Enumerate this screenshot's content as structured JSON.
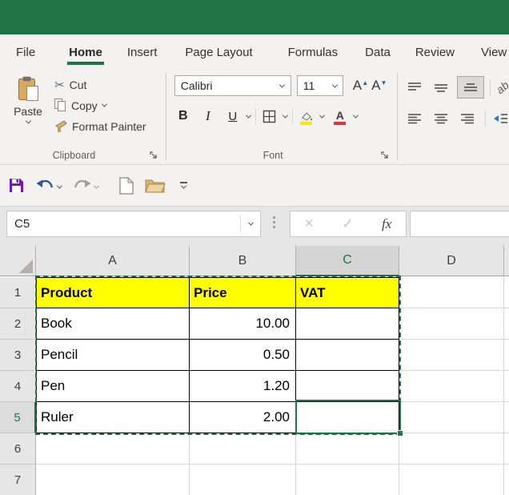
{
  "window": {
    "theme_color": "#217346"
  },
  "ribbon_tabs": [
    "File",
    "Home",
    "Insert",
    "Page Layout",
    "Formulas",
    "Data",
    "Review",
    "View"
  ],
  "active_tab": "Home",
  "clipboard": {
    "paste": "Paste",
    "cut": "Cut",
    "copy": "Copy",
    "format_painter": "Format Painter",
    "group_label": "Clipboard"
  },
  "font_group": {
    "font_name": "Calibri",
    "font_size": "11",
    "bold": "B",
    "italic": "I",
    "underline": "U",
    "grow_font": "A",
    "shrink_font": "A",
    "group_label": "Font",
    "fill_color": "#ffe600",
    "font_color_bar": "#e8322d"
  },
  "quick_access": {
    "buttons": [
      "save",
      "undo",
      "redo",
      "new-file",
      "open-folder",
      "customize"
    ]
  },
  "formula_bar": {
    "name_box": "C5",
    "cancel": "×",
    "enter": "✓",
    "insert_function": "fx",
    "formula_value": ""
  },
  "icons": {
    "cut_glyph": "✂",
    "orientation_glyph": "ab"
  },
  "sheet": {
    "columns": [
      "A",
      "B",
      "C",
      "D"
    ],
    "rows": [
      "1",
      "2",
      "3",
      "4",
      "5",
      "6",
      "7"
    ],
    "cells": {
      "1": {
        "A": "Product",
        "B": "Price",
        "C": "VAT"
      },
      "2": {
        "A": "Book",
        "B": "10.00"
      },
      "3": {
        "A": "Pencil",
        "B": "0.50"
      },
      "4": {
        "A": "Pen",
        "B": "1.20"
      },
      "5": {
        "A": "Ruler",
        "B": "2.00"
      }
    },
    "header_fill": "#FFFF00",
    "selection": {
      "active_cell": "C5",
      "marching_ants_range": "A1:C5"
    }
  },
  "colors": {
    "excel_green": "#217346",
    "highlight_yellow": "#FFFF00",
    "grid_line": "#d7d7d7",
    "cell_border_black": "#000000"
  }
}
